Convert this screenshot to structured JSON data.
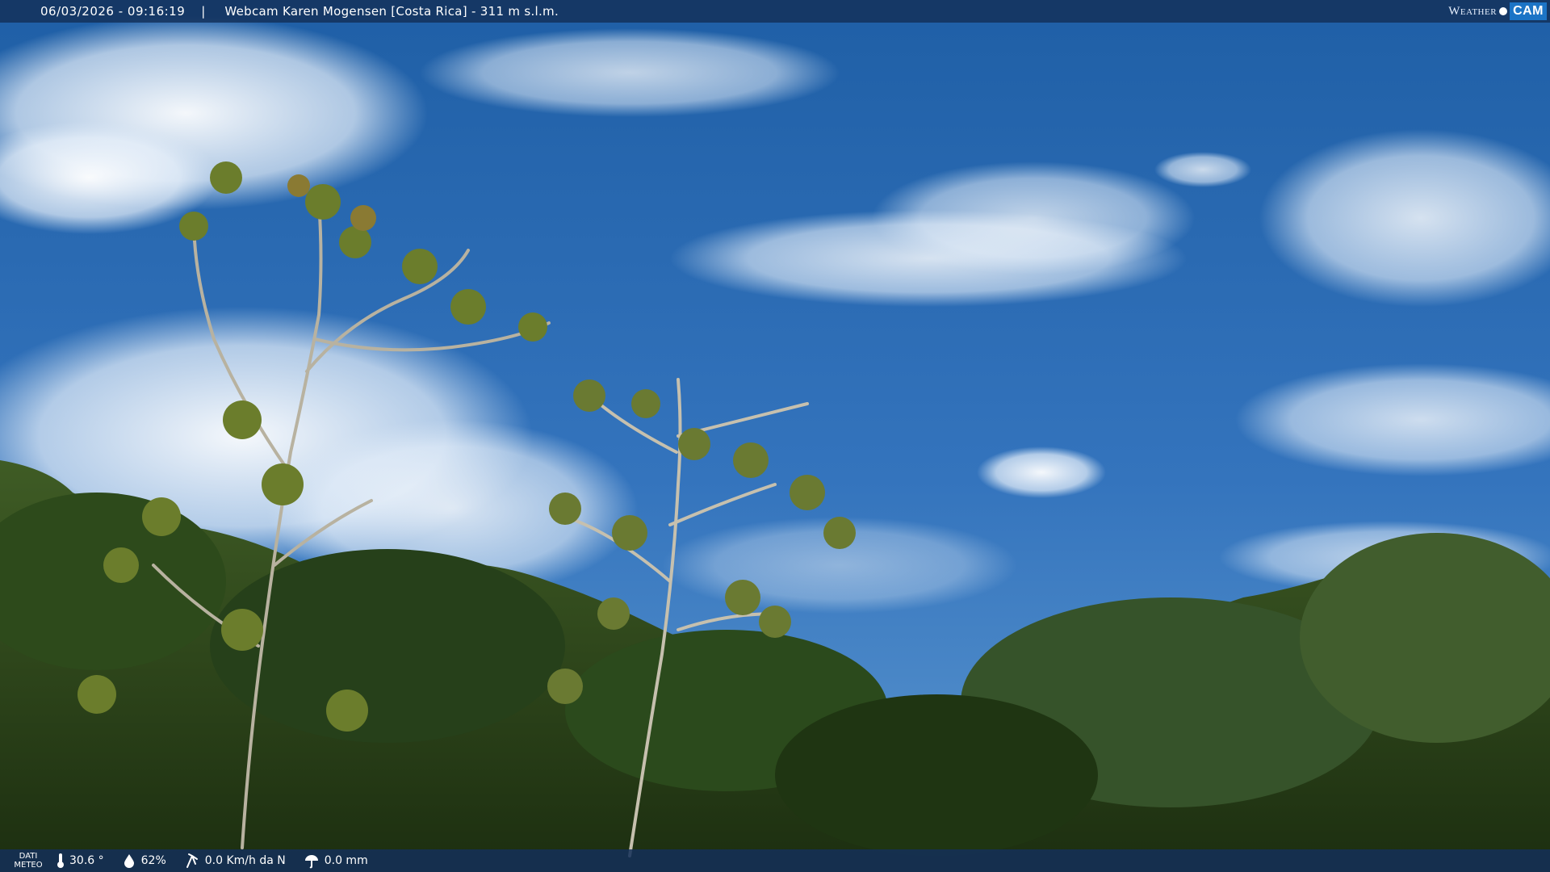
{
  "header": {
    "datetime": "06/03/2026 - 09:16:19",
    "separator": "|",
    "location": "Webcam Karen Mogensen [Costa Rica] - 311 m s.l.m."
  },
  "logo": {
    "word1": "Weather",
    "word2": "CAM"
  },
  "footer": {
    "meteo_label_line1": "DATI",
    "meteo_label_line2": "METEO",
    "temperature": "30.6 °",
    "humidity": "62%",
    "wind": "0.0 Km/h da N",
    "rain": "0.0 mm"
  },
  "colors": {
    "sky_top": "#1d5ea8",
    "sky_bottom": "#4f8fcc",
    "vegetation": "#2a4418",
    "bar": "#14305a"
  }
}
